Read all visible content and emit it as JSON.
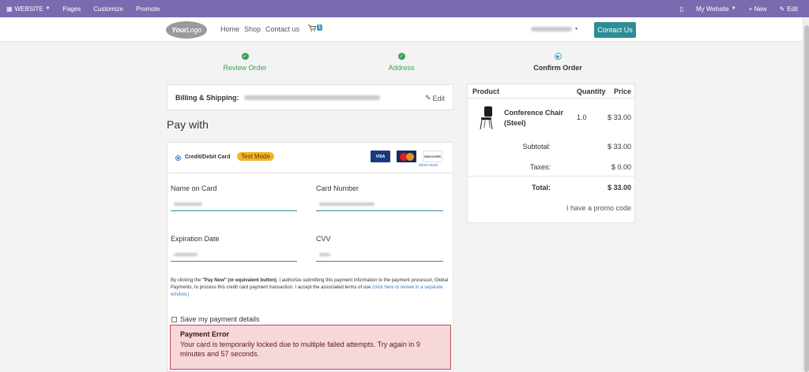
{
  "admin_bar": {
    "website_menu": "WEBSITE",
    "pages": "Pages",
    "customize": "Customize",
    "promote": "Promote",
    "my_website": "My Website",
    "new": "+ New",
    "edit": "Edit"
  },
  "header": {
    "logo": {
      "part1": "Your",
      "part2": "Logo"
    },
    "nav": [
      "Home",
      "Shop",
      "Contact us"
    ],
    "cart_count": "1",
    "contact_button": "Contact Us"
  },
  "steps": [
    {
      "label": "Review Order",
      "state": "done"
    },
    {
      "label": "Address",
      "state": "done"
    },
    {
      "label": "Confirm Order",
      "state": "current"
    }
  ],
  "billing": {
    "label": "Billing & Shipping:",
    "edit_label": "Edit"
  },
  "pay_with_title": "Pay with",
  "payment_method": {
    "label": "Credit/Debit Card",
    "badge": "Test Mode",
    "card_logos": [
      "VISA",
      "MasterCard",
      "DISCOVER"
    ],
    "show_more": "show more"
  },
  "form": {
    "name_label": "Name on Card",
    "number_label": "Card Number",
    "expiry_label": "Expiration Date",
    "cvv_label": "CVV"
  },
  "terms": {
    "prefix": "By clicking the ",
    "bold": "\"Pay Now\" (or equivalent button)",
    "body": ", I authorize submitting this payment information to the payment processor, Global Payments, to process this credit card payment transaction. I accept the associated terms of use ",
    "link": "(click here to review in a separate window.)"
  },
  "save_details": "Save my payment details",
  "error": {
    "title": "Payment Error",
    "message": "Your card is temporarily locked due to multiple failed attempts. Try again in 9 minutes and 57 seconds."
  },
  "summary": {
    "headers": {
      "product": "Product",
      "quantity": "Quantity",
      "price": "Price"
    },
    "item": {
      "name": "Conference Chair (Steel)",
      "qty": "1.0",
      "price": "$ 33.00"
    },
    "subtotal_label": "Subtotal:",
    "subtotal": "$ 33.00",
    "taxes_label": "Taxes:",
    "taxes": "$ 0.00",
    "total_label": "Total:",
    "total": "$ 33.00",
    "promo": "I have a promo code"
  },
  "colors": {
    "admin_bar": "#7a6bb0",
    "accent": "#2d8d97",
    "success": "#3aa156",
    "badge": "#f0b429",
    "error_bg": "#f6d7da",
    "error_border": "#b84a55"
  }
}
